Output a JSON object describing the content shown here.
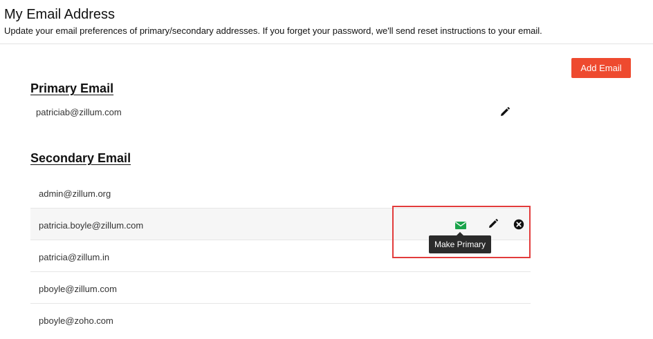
{
  "header": {
    "title": "My Email Address",
    "description": "Update your email preferences of primary/secondary addresses. If you forget your password, we'll send reset instructions to your email."
  },
  "actions": {
    "add_email_label": "Add Email"
  },
  "primary": {
    "section_title": "Primary Email",
    "email": "patriciab@zillum.com"
  },
  "secondary": {
    "section_title": "Secondary Email",
    "emails": [
      "admin@zillum.org",
      "patricia.boyle@zillum.com",
      "patricia@zillum.in",
      "pboyle@zillum.com",
      "pboyle@zoho.com"
    ],
    "hovered_index": 1
  },
  "tooltip": {
    "text": "Make Primary"
  },
  "icons": {
    "edit": "pencil-icon",
    "delete": "close-circle-icon",
    "make_primary": "envelope-icon"
  },
  "colors": {
    "accent": "#ee4a2f",
    "make_primary": "#1aa34a",
    "highlight": "#e23b3b"
  }
}
